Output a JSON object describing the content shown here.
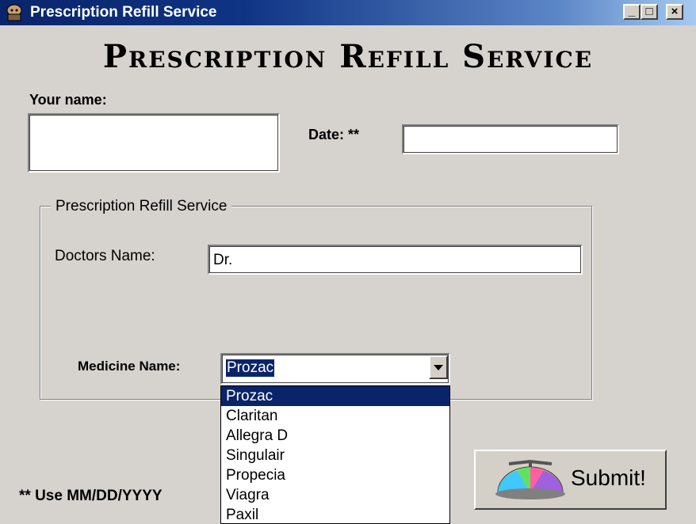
{
  "window": {
    "title": "Prescription Refill Service",
    "minimize_glyph": "_",
    "maximize_glyph": "□",
    "close_glyph": "×"
  },
  "heading": "Prescription Refill Service",
  "your_name": {
    "label": "Your name:",
    "value": ""
  },
  "date": {
    "label": "Date: **",
    "value": ""
  },
  "group": {
    "legend": "Prescription Refill Service",
    "doctor_label": "Doctors Name:",
    "doctor_value": "Dr.",
    "medicine_label": "Medicine Name:",
    "medicine_selected": "Prozac",
    "medicine_options": [
      "Prozac",
      "Claritan",
      "Allegra D",
      "Singulair",
      "Propecia",
      "Viagra",
      "Paxil"
    ]
  },
  "footnote": "** Use MM/DD/YYYY",
  "submit": {
    "label": "Submit!",
    "icon": "propeller-beanie-icon"
  },
  "colors": {
    "titlebar": "#0a246a",
    "face": "#d6d3ce",
    "selection": "#0a246a"
  }
}
